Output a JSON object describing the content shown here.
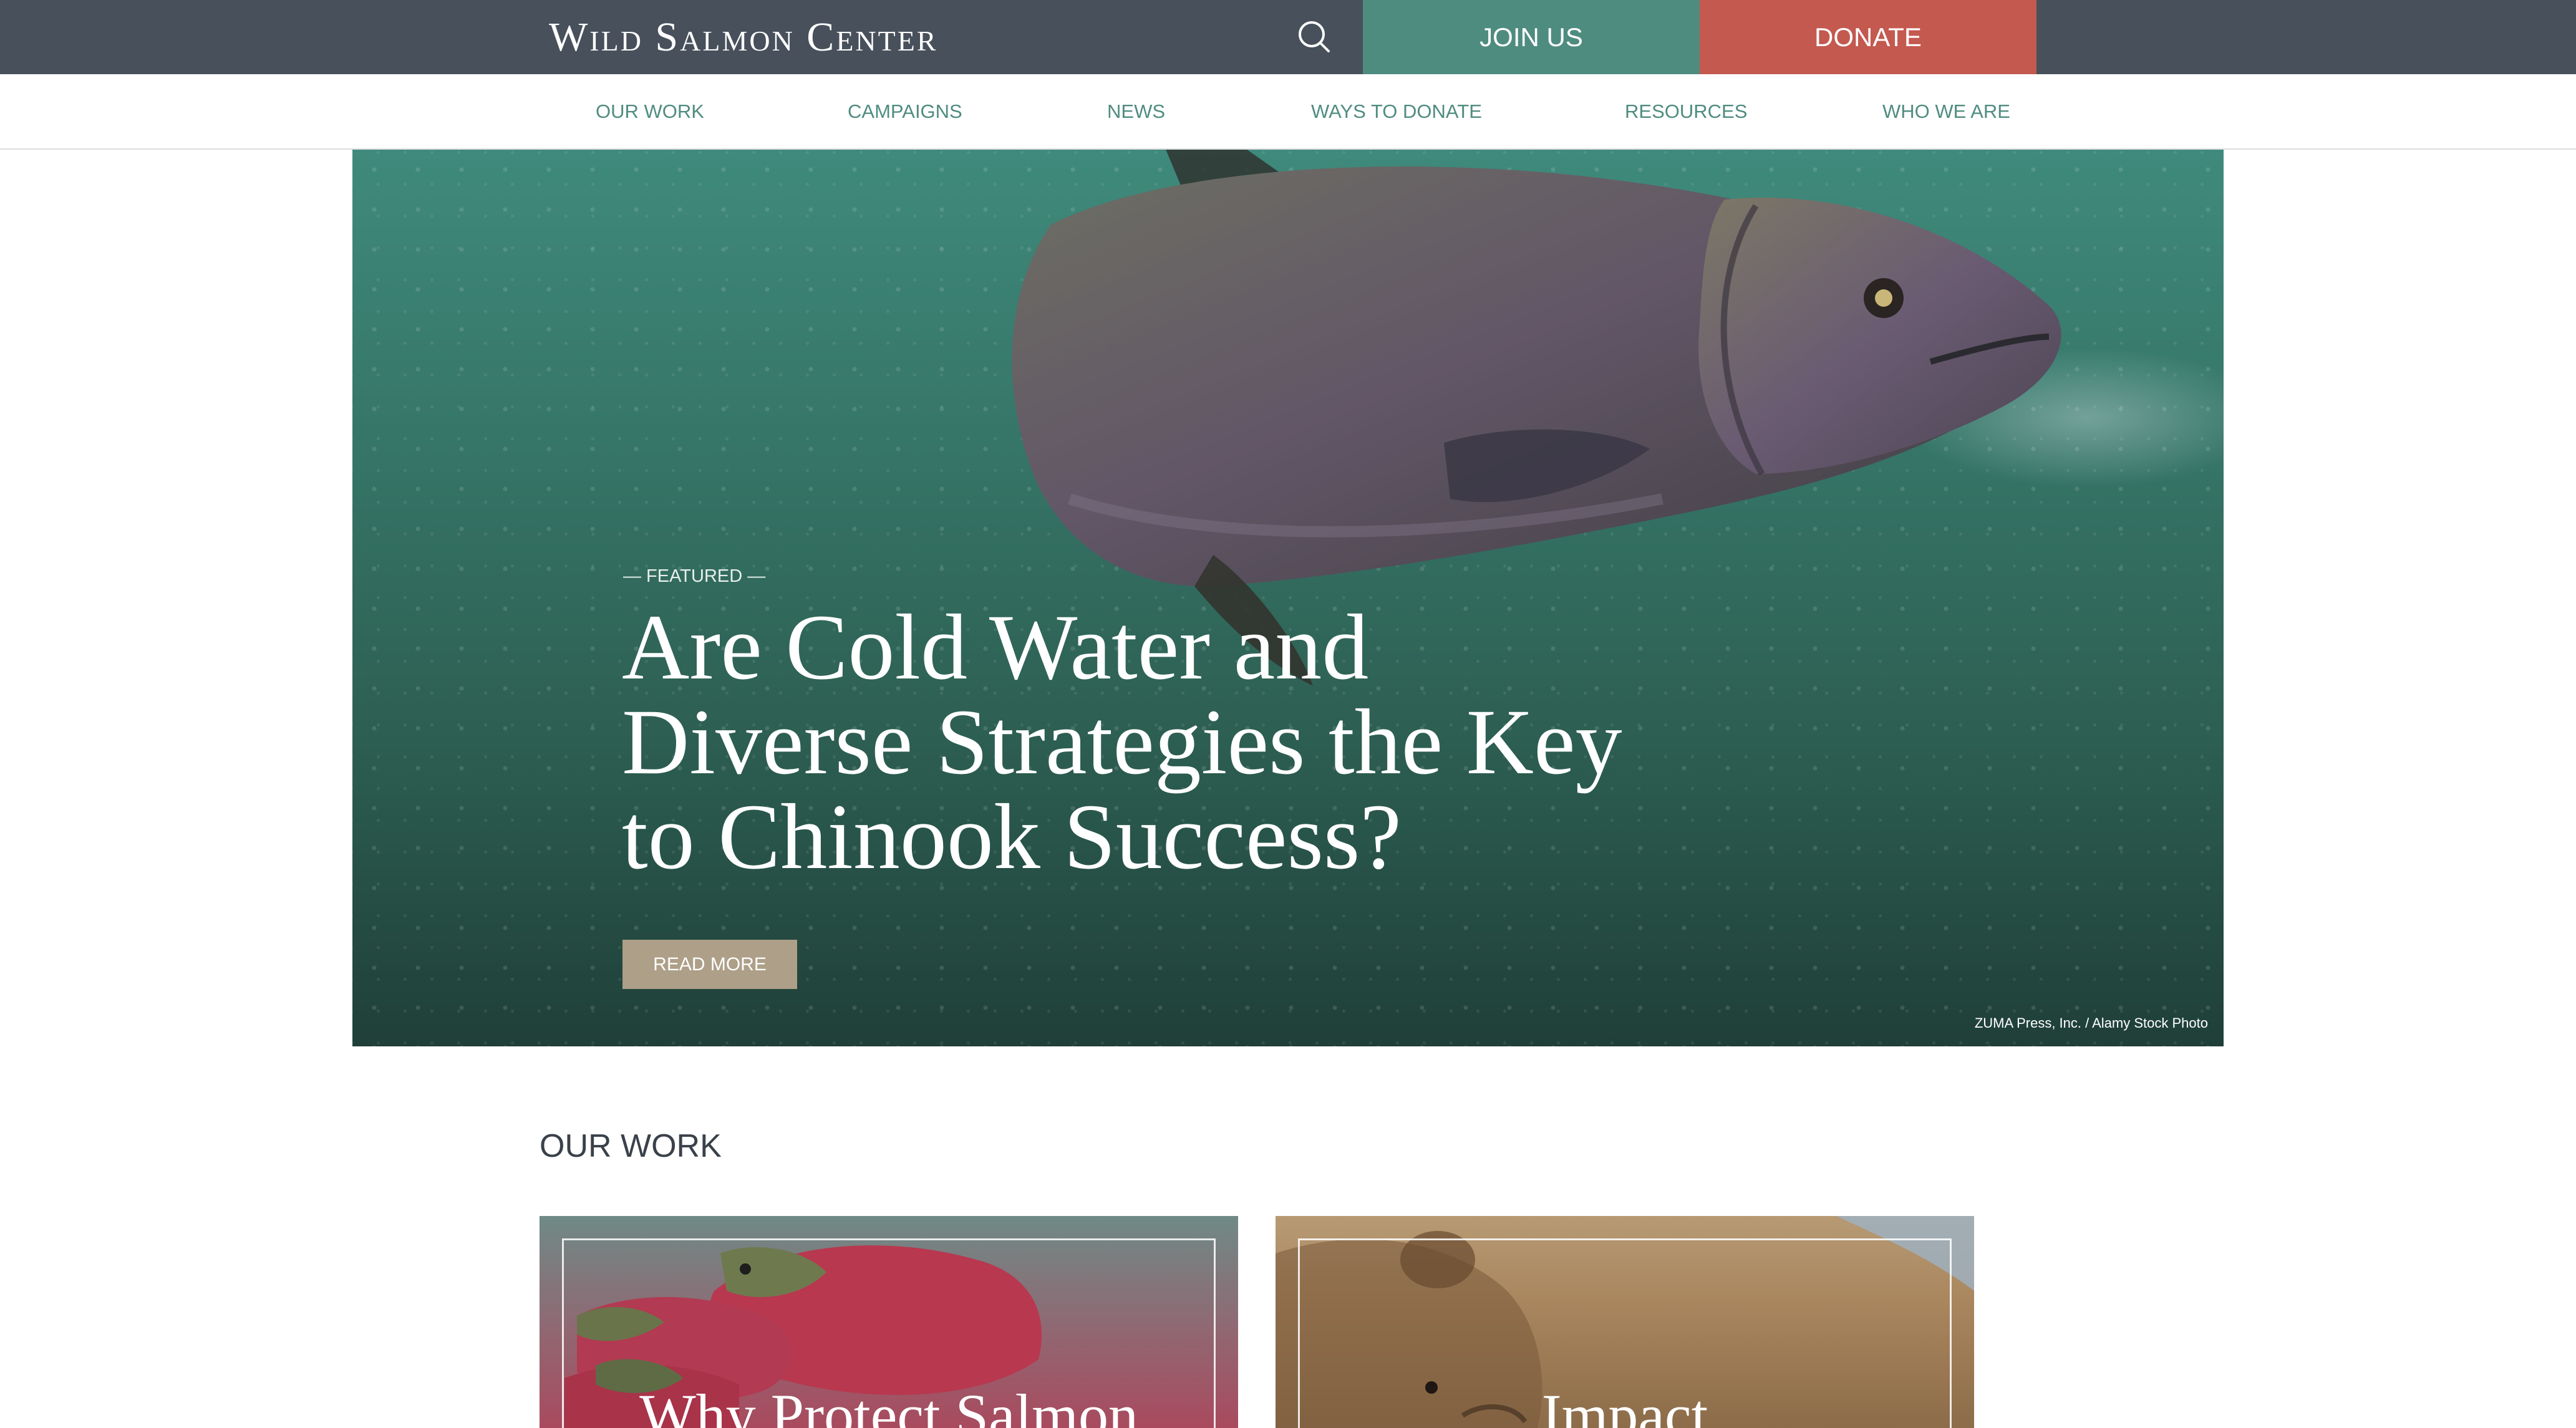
{
  "header": {
    "logo": "Wild Salmon Center",
    "search_icon": "search-icon",
    "join_label": "JOIN US",
    "donate_label": "DONATE",
    "colors": {
      "topbar": "#47505b",
      "join": "#4f8c80",
      "donate": "#c4594f"
    }
  },
  "nav": {
    "items": [
      {
        "label": "OUR WORK"
      },
      {
        "label": "CAMPAIGNS"
      },
      {
        "label": "NEWS"
      },
      {
        "label": "WAYS TO DONATE"
      },
      {
        "label": "RESOURCES"
      },
      {
        "label": "WHO WE ARE"
      }
    ],
    "color": "#4f8c80"
  },
  "hero": {
    "eyebrow": "— FEATURED —",
    "title": "Are Cold Water and Diverse Strategies the Key to Chinook Success?",
    "cta_label": "READ MORE",
    "photo_credit": "ZUMA Press, Inc. / Alamy Stock Photo"
  },
  "our_work": {
    "title": "OUR WORK",
    "cards": [
      {
        "title": "Why Protect Salmon"
      },
      {
        "title": "Impact"
      }
    ]
  }
}
